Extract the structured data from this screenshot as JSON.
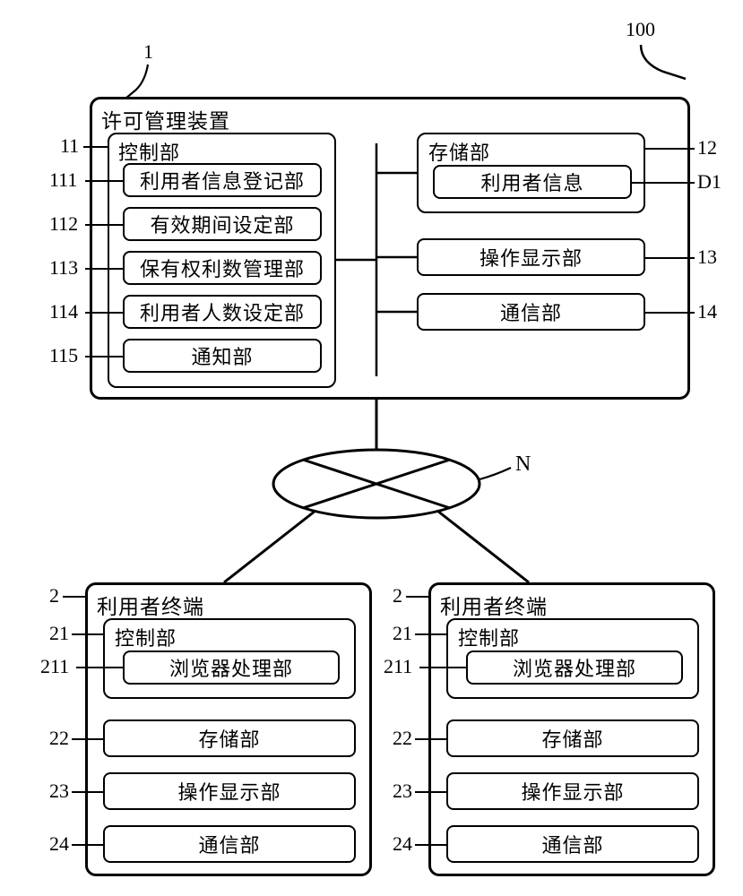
{
  "system_ref": "100",
  "server": {
    "ref": "1",
    "title": "许可管理装置",
    "control": {
      "ref": "11",
      "title": "控制部",
      "items": [
        {
          "ref": "111",
          "label": "利用者信息登记部"
        },
        {
          "ref": "112",
          "label": "有效期间设定部"
        },
        {
          "ref": "113",
          "label": "保有权利数管理部"
        },
        {
          "ref": "114",
          "label": "利用者人数设定部"
        },
        {
          "ref": "115",
          "label": "通知部"
        }
      ]
    },
    "storage": {
      "ref": "12",
      "title": "存储部",
      "data": {
        "ref": "D1",
        "label": "利用者信息"
      }
    },
    "display": {
      "ref": "13",
      "label": "操作显示部"
    },
    "comm": {
      "ref": "14",
      "label": "通信部"
    }
  },
  "network_ref": "N",
  "terminal": {
    "ref": "2",
    "title": "利用者终端",
    "control": {
      "ref": "21",
      "title": "控制部",
      "browser": {
        "ref": "211",
        "label": "浏览器处理部"
      }
    },
    "storage": {
      "ref": "22",
      "label": "存储部"
    },
    "display": {
      "ref": "23",
      "label": "操作显示部"
    },
    "comm": {
      "ref": "24",
      "label": "通信部"
    }
  }
}
